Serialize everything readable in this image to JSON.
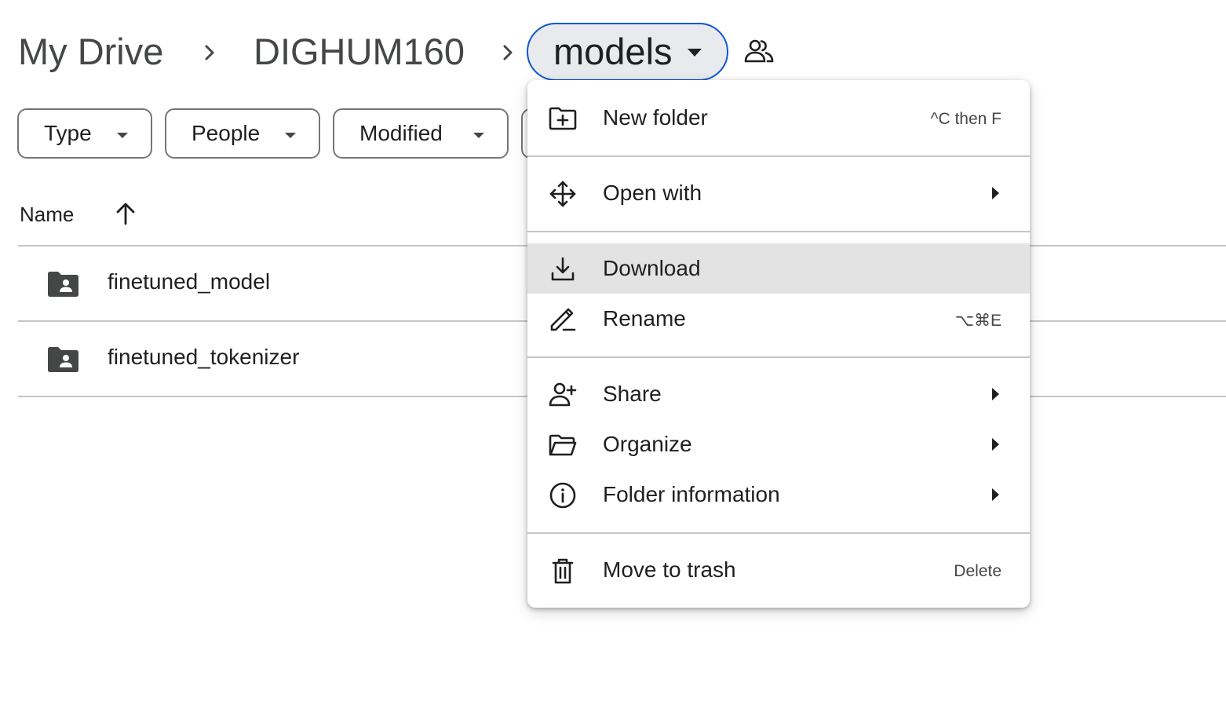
{
  "breadcrumb": {
    "root": "My Drive",
    "parent": "DIGHUM160",
    "current": "models"
  },
  "filters": {
    "type": "Type",
    "people": "People",
    "modified": "Modified"
  },
  "list": {
    "header": {
      "name": "Name"
    },
    "items": [
      {
        "name": "finetuned_model"
      },
      {
        "name": "finetuned_tokenizer"
      }
    ]
  },
  "menu": {
    "new_folder": {
      "label": "New folder",
      "shortcut": "^C then F"
    },
    "open_with": {
      "label": "Open with"
    },
    "download": {
      "label": "Download"
    },
    "rename": {
      "label": "Rename",
      "shortcut": "⌥⌘E"
    },
    "share": {
      "label": "Share"
    },
    "organize": {
      "label": "Organize"
    },
    "folder_information": {
      "label": "Folder information"
    },
    "move_to_trash": {
      "label": "Move to trash",
      "shortcut": "Delete"
    }
  },
  "colors": {
    "accent": "#0b57d0",
    "highlight": "#e3e3e3",
    "text": "#1f1f1f",
    "muted": "#444746"
  }
}
